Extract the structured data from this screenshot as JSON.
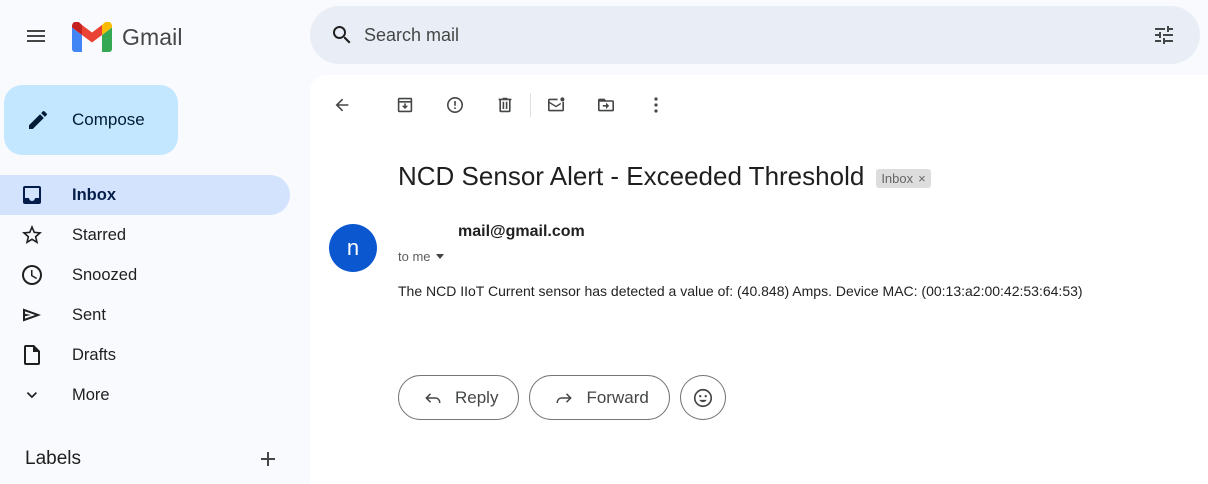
{
  "app": {
    "name": "Gmail"
  },
  "search": {
    "placeholder": "Search mail"
  },
  "sidebar": {
    "compose_label": "Compose",
    "items": [
      {
        "label": "Inbox",
        "icon": "inbox-icon",
        "active": true
      },
      {
        "label": "Starred",
        "icon": "star-icon"
      },
      {
        "label": "Snoozed",
        "icon": "clock-icon"
      },
      {
        "label": "Sent",
        "icon": "send-icon"
      },
      {
        "label": "Drafts",
        "icon": "draft-icon"
      },
      {
        "label": "More",
        "icon": "chevron-down-icon"
      }
    ],
    "labels_title": "Labels"
  },
  "toolbar": {
    "icons": [
      "back-arrow-icon",
      "archive-icon",
      "report-spam-icon",
      "delete-icon",
      "mark-unread-icon",
      "move-to-icon",
      "more-vert-icon"
    ]
  },
  "email": {
    "subject": "NCD Sensor Alert - Exceeded Threshold",
    "label_chip": "Inbox",
    "label_remove": "×",
    "avatar_letter": "n",
    "sender": "mail@gmail.com",
    "to": "to me",
    "body": "The NCD IIoT Current sensor has detected a value of:  (40.848) Amps. Device MAC: (00:13:a2:00:42:53:64:53)"
  },
  "actions": {
    "reply_label": "Reply",
    "forward_label": "Forward"
  },
  "colors": {
    "compose_bg": "#c2e7ff",
    "active_nav_bg": "#d3e3fd",
    "search_bg": "#e9eef6",
    "avatar_bg": "#0b57d0",
    "app_bg": "#f8fafd"
  }
}
